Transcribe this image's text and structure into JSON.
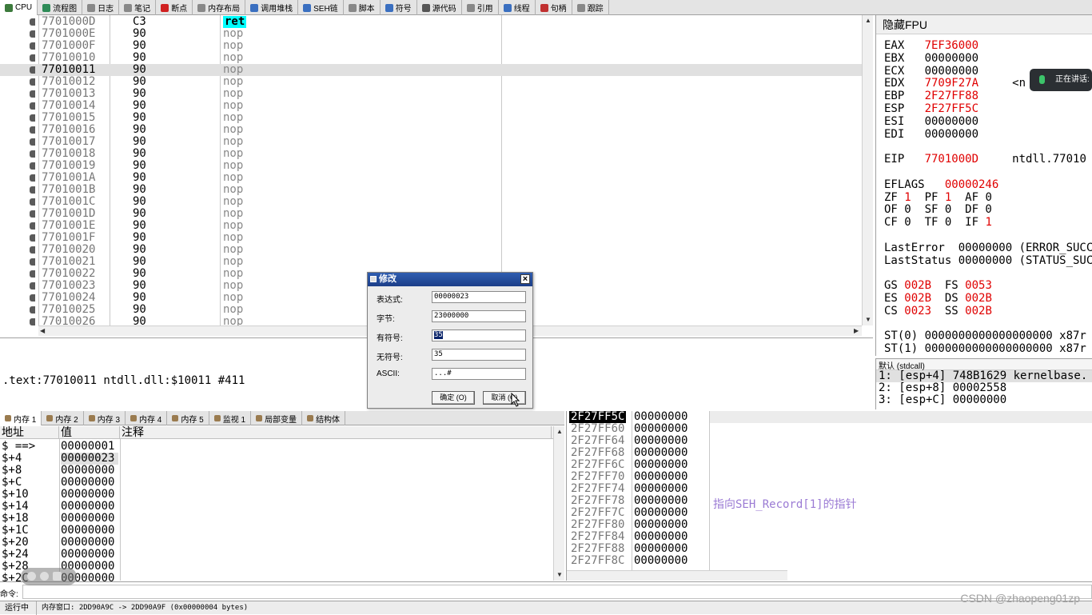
{
  "toolbar": {
    "tabs": [
      {
        "label": "CPU",
        "color": "#3c7a3c"
      },
      {
        "label": "流程图",
        "color": "#2e8b57"
      },
      {
        "label": "日志",
        "color": "#888888"
      },
      {
        "label": "笔记",
        "color": "#888888"
      },
      {
        "label": "断点",
        "color": "#d02020"
      },
      {
        "label": "内存布局",
        "color": "#888888"
      },
      {
        "label": "调用堆栈",
        "color": "#3a6fc0"
      },
      {
        "label": "SEH链",
        "color": "#3a6fc0"
      },
      {
        "label": "脚本",
        "color": "#888888"
      },
      {
        "label": "符号",
        "color": "#3a6fc0"
      },
      {
        "label": "源代码",
        "color": "#555555"
      },
      {
        "label": "引用",
        "color": "#888888"
      },
      {
        "label": "线程",
        "color": "#3a6fc0"
      },
      {
        "label": "句柄",
        "color": "#c03030"
      },
      {
        "label": "跟踪",
        "color": "#888888"
      }
    ]
  },
  "disasm": {
    "rows": [
      {
        "addr": "7701000D",
        "bytes": "C3",
        "ins": "ret"
      },
      {
        "addr": "7701000E",
        "bytes": "90",
        "ins": "nop"
      },
      {
        "addr": "7701000F",
        "bytes": "90",
        "ins": "nop"
      },
      {
        "addr": "77010010",
        "bytes": "90",
        "ins": "nop"
      },
      {
        "addr": "77010011",
        "bytes": "90",
        "ins": "nop"
      },
      {
        "addr": "77010012",
        "bytes": "90",
        "ins": "nop"
      },
      {
        "addr": "77010013",
        "bytes": "90",
        "ins": "nop"
      },
      {
        "addr": "77010014",
        "bytes": "90",
        "ins": "nop"
      },
      {
        "addr": "77010015",
        "bytes": "90",
        "ins": "nop"
      },
      {
        "addr": "77010016",
        "bytes": "90",
        "ins": "nop"
      },
      {
        "addr": "77010017",
        "bytes": "90",
        "ins": "nop"
      },
      {
        "addr": "77010018",
        "bytes": "90",
        "ins": "nop"
      },
      {
        "addr": "77010019",
        "bytes": "90",
        "ins": "nop"
      },
      {
        "addr": "7701001A",
        "bytes": "90",
        "ins": "nop"
      },
      {
        "addr": "7701001B",
        "bytes": "90",
        "ins": "nop"
      },
      {
        "addr": "7701001C",
        "bytes": "90",
        "ins": "nop"
      },
      {
        "addr": "7701001D",
        "bytes": "90",
        "ins": "nop"
      },
      {
        "addr": "7701001E",
        "bytes": "90",
        "ins": "nop"
      },
      {
        "addr": "7701001F",
        "bytes": "90",
        "ins": "nop"
      },
      {
        "addr": "77010020",
        "bytes": "90",
        "ins": "nop"
      },
      {
        "addr": "77010021",
        "bytes": "90",
        "ins": "nop"
      },
      {
        "addr": "77010022",
        "bytes": "90",
        "ins": "nop"
      },
      {
        "addr": "77010023",
        "bytes": "90",
        "ins": "nop"
      },
      {
        "addr": "77010024",
        "bytes": "90",
        "ins": "nop"
      },
      {
        "addr": "77010025",
        "bytes": "90",
        "ins": "nop"
      },
      {
        "addr": "77010026",
        "bytes": "90",
        "ins": "nop"
      }
    ],
    "selected_addr": "77010011"
  },
  "info": {
    "text": ".text:77010011 ntdll.dll:$10011 #411"
  },
  "registers": {
    "title": "隐藏FPU",
    "lines": [
      [
        {
          "t": "EAX   "
        },
        {
          "t": "7EF36000",
          "red": true
        }
      ],
      [
        {
          "t": "EBX   00000000"
        }
      ],
      [
        {
          "t": "ECX   00000000"
        }
      ],
      [
        {
          "t": "EDX   "
        },
        {
          "t": "7709F27A",
          "red": true
        },
        {
          "t": "     <n"
        }
      ],
      [
        {
          "t": "EBP   "
        },
        {
          "t": "2F27FF88",
          "red": true
        }
      ],
      [
        {
          "t": "ESP   "
        },
        {
          "t": "2F27FF5C",
          "red": true
        }
      ],
      [
        {
          "t": "ESI   00000000"
        }
      ],
      [
        {
          "t": "EDI   00000000"
        }
      ],
      [
        {
          "t": ""
        }
      ],
      [
        {
          "t": "EIP   "
        },
        {
          "t": "7701000D",
          "red": true
        },
        {
          "t": "     ntdll.77010"
        }
      ],
      [
        {
          "t": ""
        }
      ],
      [
        {
          "t": "EFLAGS   "
        },
        {
          "t": "00000246",
          "red": true
        }
      ],
      [
        {
          "t": "ZF "
        },
        {
          "t": "1",
          "red": true
        },
        {
          "t": "  PF "
        },
        {
          "t": "1",
          "red": true
        },
        {
          "t": "  AF 0"
        }
      ],
      [
        {
          "t": "OF 0  SF 0  DF 0"
        }
      ],
      [
        {
          "t": "CF 0  TF 0  IF "
        },
        {
          "t": "1",
          "red": true
        }
      ],
      [
        {
          "t": ""
        }
      ],
      [
        {
          "t": "LastError  00000000 (ERROR_SUCC"
        }
      ],
      [
        {
          "t": "LastStatus 00000000 (STATUS_SUC"
        }
      ],
      [
        {
          "t": ""
        }
      ],
      [
        {
          "t": "GS "
        },
        {
          "t": "002B",
          "red": true
        },
        {
          "t": "  FS "
        },
        {
          "t": "0053",
          "red": true
        }
      ],
      [
        {
          "t": "ES "
        },
        {
          "t": "002B",
          "red": true
        },
        {
          "t": "  DS "
        },
        {
          "t": "002B",
          "red": true
        }
      ],
      [
        {
          "t": "CS "
        },
        {
          "t": "0023",
          "red": true
        },
        {
          "t": "  SS "
        },
        {
          "t": "002B",
          "red": true
        }
      ],
      [
        {
          "t": ""
        }
      ],
      [
        {
          "t": "ST(0) 0000000000000000000 x87r"
        }
      ],
      [
        {
          "t": "ST(1) 0000000000000000000 x87r"
        }
      ]
    ]
  },
  "callstack": {
    "header": "默认 (stdcall)",
    "rows": [
      "1: [esp+4] 748B1629 kernelbase.",
      "2: [esp+8] 00002558",
      "3: [esp+C] 00000000"
    ]
  },
  "memtabs": {
    "tabs": [
      {
        "label": "内存 1",
        "active": true
      },
      {
        "label": "内存 2"
      },
      {
        "label": "内存 3"
      },
      {
        "label": "内存 4"
      },
      {
        "label": "内存 5"
      },
      {
        "label": "监视 1"
      },
      {
        "label": "局部变量"
      },
      {
        "label": "结构体"
      }
    ]
  },
  "dump": {
    "headers": [
      "地址",
      "值",
      "注释"
    ],
    "rows": [
      {
        "addr": "$ ==>",
        "val": "00000001"
      },
      {
        "addr": "$+4",
        "val": "00000023",
        "hl": true
      },
      {
        "addr": "$+8",
        "val": "00000000"
      },
      {
        "addr": "$+C",
        "val": "00000000"
      },
      {
        "addr": "$+10",
        "val": "00000000"
      },
      {
        "addr": "$+14",
        "val": "00000000"
      },
      {
        "addr": "$+18",
        "val": "00000000"
      },
      {
        "addr": "$+1C",
        "val": "00000000"
      },
      {
        "addr": "$+20",
        "val": "00000000"
      },
      {
        "addr": "$+24",
        "val": "00000000"
      },
      {
        "addr": "$+28",
        "val": "00000000"
      },
      {
        "addr": "$+2C",
        "val": "00000000"
      }
    ]
  },
  "stack": {
    "rows": [
      {
        "addr": "2F27FF5C",
        "val": "00000000"
      },
      {
        "addr": "2F27FF60",
        "val": "00000000"
      },
      {
        "addr": "2F27FF64",
        "val": "00000000"
      },
      {
        "addr": "2F27FF68",
        "val": "00000000"
      },
      {
        "addr": "2F27FF6C",
        "val": "00000000"
      },
      {
        "addr": "2F27FF70",
        "val": "00000000"
      },
      {
        "addr": "2F27FF74",
        "val": "00000000"
      },
      {
        "addr": "2F27FF78",
        "val": "00000000"
      },
      {
        "addr": "2F27FF7C",
        "val": "00000000"
      },
      {
        "addr": "2F27FF80",
        "val": "00000000"
      },
      {
        "addr": "2F27FF84",
        "val": "00000000"
      },
      {
        "addr": "2F27FF88",
        "val": "00000000"
      },
      {
        "addr": "2F27FF8C",
        "val": "00000000"
      }
    ],
    "comment": "指向SEH_Record[1]的指针"
  },
  "command": {
    "label": "命令:",
    "value": ""
  },
  "status": {
    "state": "运行中",
    "message": "内存窗口: 2DD90A9C -> 2DD90A9F (0x00000004 bytes)"
  },
  "dialog": {
    "title": "修改",
    "close": "×",
    "fields": [
      {
        "label": "表达式:",
        "value": "00000023"
      },
      {
        "label": "字节:",
        "value": "23000000"
      },
      {
        "label": "有符号:",
        "value": "35",
        "selected": true
      },
      {
        "label": "无符号:",
        "value": "35"
      },
      {
        "label": "ASCII:",
        "value": "...#"
      }
    ],
    "ok": "确定 (O)",
    "cancel": "取消 (C)"
  },
  "overlay": {
    "speaking": "正在讲话:"
  },
  "watermark": "CSDN @zhaopeng01zp"
}
